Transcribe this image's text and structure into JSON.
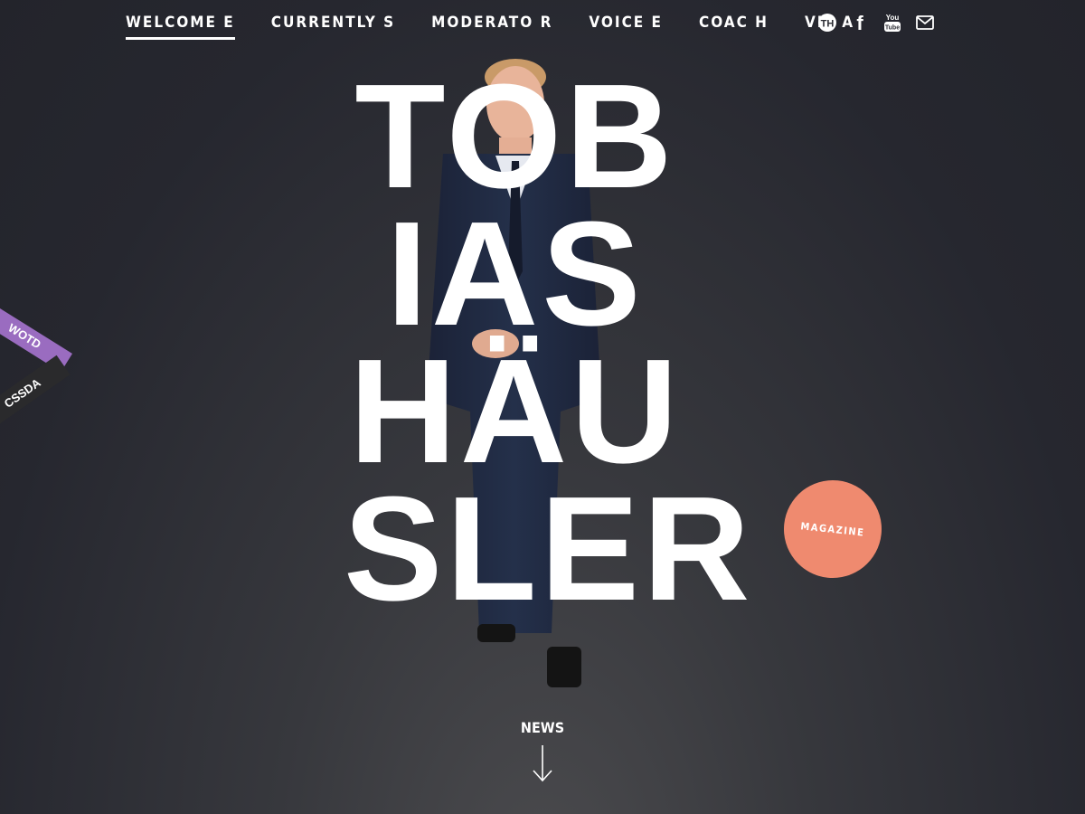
{
  "nav": {
    "items": [
      {
        "label": "WELCOME E",
        "active": true
      },
      {
        "label": "CURRENTLY S",
        "active": false
      },
      {
        "label": "MODERATO R",
        "active": false
      },
      {
        "label": "VOICE E",
        "active": false
      },
      {
        "label": "COAC H",
        "active": false
      },
      {
        "label": "VIT A",
        "active": false
      }
    ]
  },
  "social": {
    "logo_text": "TH",
    "facebook_text": "f",
    "youtube_text_top": "You",
    "youtube_text_bottom": "Tube"
  },
  "hero": {
    "name_lines": [
      "TOB",
      "IAS",
      "HÄU",
      "SLER"
    ]
  },
  "badges": {
    "wotd": "WOTD",
    "cssda": "CSSDA"
  },
  "magazine_label": "MAGAZINE",
  "news_label": "NEWS",
  "colors": {
    "accent": "#ef8a6f",
    "wotd_badge": "#9a6cc0",
    "background": "#2e2f36",
    "text": "#ffffff"
  }
}
